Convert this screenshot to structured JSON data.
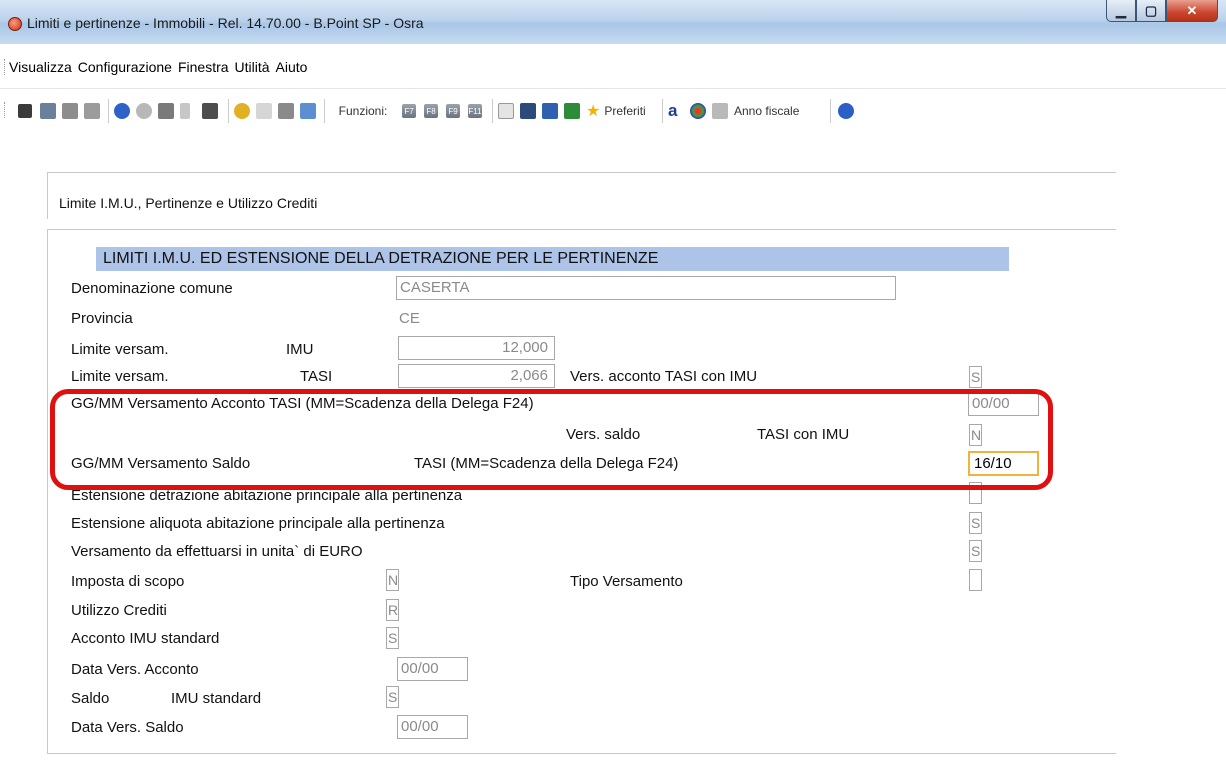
{
  "window": {
    "title": "Limiti e pertinenze - Immobili - Rel. 14.70.00 - B.Point SP - Osra",
    "icon": "app-orb-icon"
  },
  "menu": {
    "items": [
      "Visualizza",
      "Configurazione",
      "Finestra",
      "Utilità",
      "Aiuto"
    ]
  },
  "toolbar": {
    "funzioni_label": "Funzioni:",
    "fkeys": [
      "F7",
      "F8",
      "F9",
      "F11"
    ],
    "preferiti_label": "Preferiti",
    "anno_fiscale_label": "Anno fiscale"
  },
  "panel1": {
    "label": "Limite I.M.U., Pertinenze e Utilizzo Crediti"
  },
  "section": {
    "title": "LIMITI I.M.U. ED ESTENSIONE DELLA DETRAZIONE PER LE PERTINENZE"
  },
  "form": {
    "denominazione_label": "Denominazione comune",
    "denominazione_value": "CASERTA",
    "provincia_label": "Provincia",
    "provincia_value": "CE",
    "limite1_label": "Limite versam.",
    "limite1_type": "IMU",
    "limite1_value": "12,000",
    "limite2_label": "Limite versam.",
    "limite2_type": "TASI",
    "limite2_value": "2,066",
    "vers_acconto_label": "Vers. acconto TASI con IMU",
    "vers_acconto_value": "S",
    "ggmm_acconto_label": "GG/MM Versamento Acconto TASI (MM=Scadenza della Delega F24)",
    "ggmm_acconto_value": "00/00",
    "vers_saldo_label": "Vers. saldo",
    "tasi_con_imu_label": "TASI con IMU",
    "vers_saldo_value": "N",
    "ggmm_saldo_label": "GG/MM Versamento Saldo",
    "ggmm_saldo_desc": "TASI (MM=Scadenza della Delega F24)",
    "ggmm_saldo_value": "16/10",
    "est_detrazione_label": "Estensione detrazione abitazione principale alla pertinenza",
    "est_detrazione_value": "",
    "est_aliquota_label": "Estensione aliquota abitazione principale alla pertinenza",
    "est_aliquota_value": "S",
    "vers_euro_label": "Versamento da effettuarsi in unita` di EURO",
    "vers_euro_value": "S",
    "imposta_scopo_label": "Imposta di scopo",
    "imposta_scopo_value": "N",
    "tipo_versamento_label": "Tipo Versamento",
    "tipo_versamento_value": "",
    "utilizzo_crediti_label": "Utilizzo Crediti",
    "utilizzo_crediti_value": "R",
    "acconto_imu_label": "Acconto IMU standard",
    "acconto_imu_value": "S",
    "data_acconto_label": "Data Vers. Acconto",
    "data_acconto_value": "00/00",
    "saldo_label": "Saldo",
    "saldo_imu_label": "IMU standard",
    "saldo_imu_value": "S",
    "data_saldo_label": "Data Vers. Saldo",
    "data_saldo_value": "00/00"
  },
  "colors": {
    "section_header": "#adc3e8",
    "highlight_border": "#e01010",
    "active_field_border": "#f2b33d"
  }
}
